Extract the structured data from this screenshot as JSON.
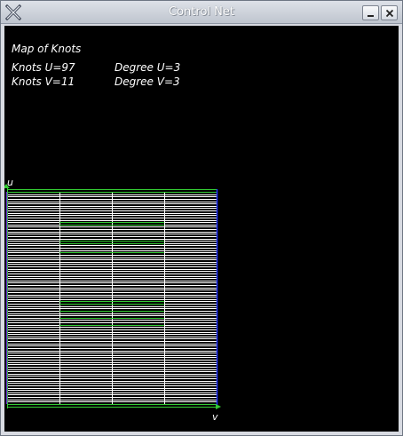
{
  "window": {
    "title": "Control Net",
    "icon": "x-logo-icon",
    "buttons": {
      "minimize": "minimize-icon",
      "close": "close-icon"
    }
  },
  "info": {
    "heading": "Map of Knots",
    "knots_u": "Knots U=97",
    "knots_v": "Knots V=11",
    "degree_u": "Degree U=3",
    "degree_v": "Degree V=3"
  },
  "axes": {
    "u_label": "u",
    "v_label": "v"
  },
  "knot_map": {
    "knot_count_u": 97,
    "knot_count_v": 11,
    "degree_u": 3,
    "degree_v": 3,
    "v_divisions": 4,
    "colors": {
      "background": "#000000",
      "grid": "#ffffff",
      "boundary": "#33cc33",
      "v_axis": "#2233ff"
    }
  }
}
